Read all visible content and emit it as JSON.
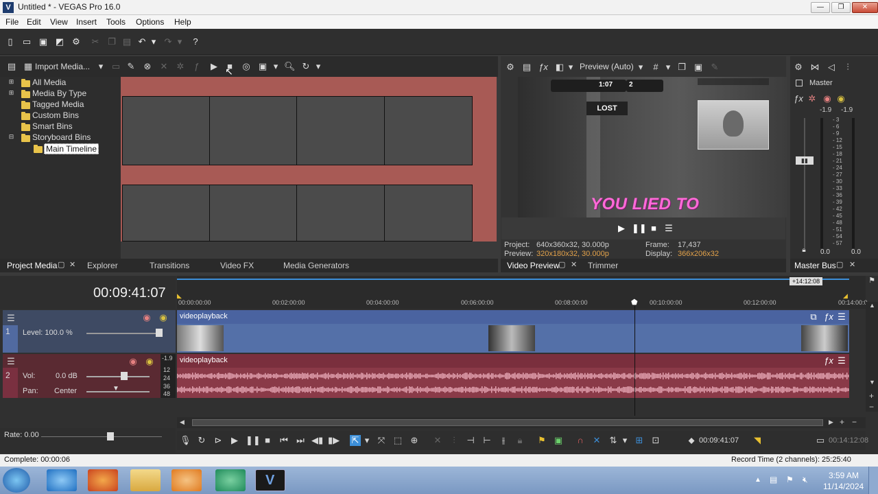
{
  "window": {
    "title": "Untitled * - VEGAS Pro 16.0",
    "logo_letter": "V",
    "min": "—",
    "max": "❐",
    "close": "✕"
  },
  "menu": [
    "File",
    "Edit",
    "View",
    "Insert",
    "Tools",
    "Options",
    "Help"
  ],
  "media_panel": {
    "import_label": "Import Media...",
    "tree": [
      {
        "label": "All Media"
      },
      {
        "label": "Media By Type"
      },
      {
        "label": "Tagged Media"
      },
      {
        "label": "Custom Bins"
      },
      {
        "label": "Smart Bins"
      },
      {
        "label": "Storyboard Bins"
      },
      {
        "label": "Main Timeline"
      }
    ],
    "tabs": [
      "Project Media",
      "Explorer",
      "Transitions",
      "Video FX",
      "Media Generators"
    ]
  },
  "preview": {
    "mode": "Preview (Auto)",
    "project_label": "Project:",
    "project_value": "640x360x32, 30.000p",
    "preview_label": "Preview:",
    "preview_value": "320x180x32, 30.000p",
    "frame_label": "Frame:",
    "frame_value": "17,437",
    "display_label": "Display:",
    "display_value": "366x206x32",
    "overlay_text": "YOU LIED TO",
    "lost_text": "LOST",
    "hud_time": "1:07",
    "hud_count": "2",
    "tabs": [
      "Video Preview",
      "Trimmer"
    ]
  },
  "master": {
    "label": "Master",
    "left_peak": "-1.9",
    "right_peak": "-1.9",
    "scale": [
      "3",
      "6",
      "9",
      "12",
      "15",
      "18",
      "21",
      "24",
      "27",
      "30",
      "33",
      "36",
      "39",
      "42",
      "45",
      "48",
      "51",
      "54",
      "57"
    ],
    "bottom_left": "0.0",
    "bottom_right": "0.0",
    "tab": "Master Bus"
  },
  "timeline": {
    "timecode": "00:09:41:07",
    "region_len": "+14:12:08",
    "ruler": [
      "00:00:00:00",
      "00:02:00:00",
      "00:04:00:00",
      "00:06:00:00",
      "00:08:00:00",
      "00:10:00:00",
      "00:12:00:00",
      "00:14:00:0"
    ],
    "video_track": {
      "number": "1",
      "level_label": "Level: 100.0 %",
      "clip_name": "videoplayback"
    },
    "audio_track": {
      "number": "2",
      "vol_label": "Vol:",
      "vol_value": "0.0 dB",
      "pan_label": "Pan:",
      "pan_value": "Center",
      "clip_name": "videoplayback",
      "peak": "-1.9",
      "meter_scale": [
        "12",
        "24",
        "36",
        "48"
      ]
    },
    "rate": "Rate: 0.00",
    "cursor_time": "00:09:41:07",
    "end_time": "00:14:12:08"
  },
  "status": {
    "complete": "Complete: 00:00:06",
    "record_time": "Record Time (2 channels): 25:25:40"
  },
  "taskbar": {
    "time": "3:59 AM",
    "date": "11/14/2024"
  },
  "colors": {
    "video_clip": "#5470a8",
    "audio_clip": "#8a3a48",
    "storyboard_bg": "#a85a55",
    "accent_blue": "#3d8fd8"
  }
}
